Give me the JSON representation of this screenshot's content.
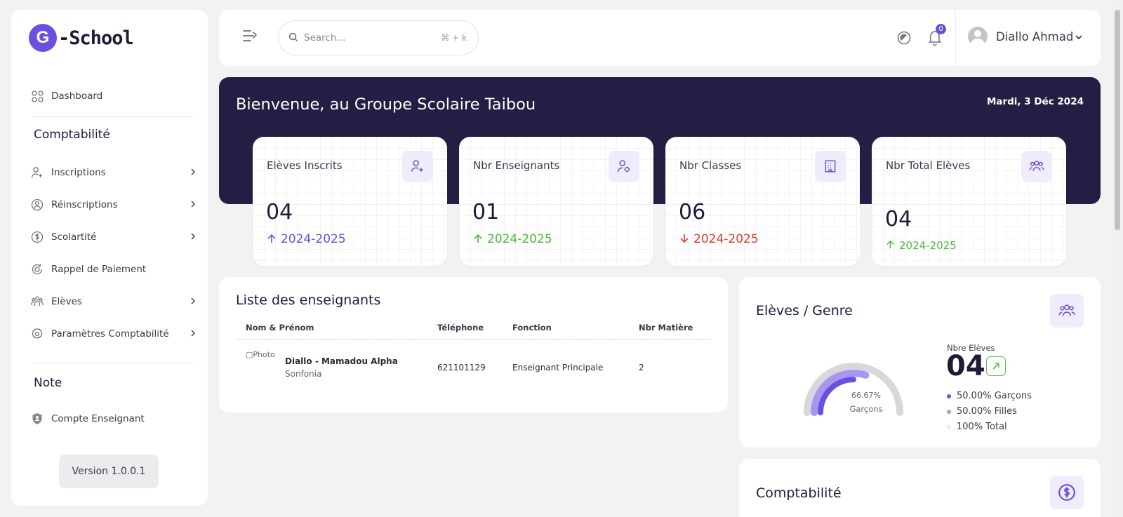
{
  "brand": {
    "logo_letter": "G",
    "name": "-School",
    "accent": "#6c4fe0"
  },
  "sidebar": {
    "dashboard": "Dashboard",
    "section1": "Comptabilité",
    "items": [
      {
        "label": "Inscriptions",
        "icon": "user-add-icon"
      },
      {
        "label": "Réinscriptions",
        "icon": "user-circle-icon"
      },
      {
        "label": "Scolartité",
        "icon": "dollar-circle-icon"
      },
      {
        "label": "Rappel de Paiement",
        "icon": "refresh-dollar-icon"
      },
      {
        "label": "Elèves",
        "icon": "users-icon"
      },
      {
        "label": "Paramètres Comptabilité",
        "icon": "gear-icon"
      }
    ],
    "section2": "Note",
    "note_item": "Compte Enseignant",
    "version": "Version 1.0.0.1"
  },
  "topbar": {
    "search_placeholder": "Search...",
    "search_shortcut": "⌘ + k",
    "notification_count": "0",
    "user_name": "Diallo Ahmad"
  },
  "banner": {
    "welcome": "Bienvenue, au Groupe Scolaire Taibou",
    "date": "Mardi, 3 Déc 2024"
  },
  "stats": [
    {
      "label": "Elèves Inscrits",
      "value": "04",
      "year": "2024-2025",
      "trend": "up",
      "color": "#6c4fe0"
    },
    {
      "label": "Nbr Enseignants",
      "value": "01",
      "year": "2024-2025",
      "trend": "up",
      "color": "#4cb83a"
    },
    {
      "label": "Nbr Classes",
      "value": "06",
      "year": "2024-2025",
      "trend": "down",
      "color": "#e5382a"
    },
    {
      "label": "Nbr Total Elèves",
      "value": "04",
      "year": "2024-2025",
      "trend": "up",
      "color": "#4cb83a"
    }
  ],
  "teachers": {
    "title": "Liste des enseignants",
    "columns": [
      "Nom & Prénom",
      "Téléphone",
      "Fonction",
      "Nbr Matière"
    ],
    "rows": [
      {
        "photo_alt": "Photo",
        "name": "Diallo - Mamadou Alpha",
        "location": "Sonfonia",
        "phone": "621101129",
        "fonction": "Enseignant Principale",
        "matieres": "2"
      }
    ]
  },
  "gender": {
    "title": "Elèves / Genre",
    "gauge_pct": "66.67%",
    "gauge_label": "Garçons",
    "gauge_fraction": 0.6667,
    "nbre_label": "Nbre Elèves",
    "nbre_value": "04",
    "legend": [
      {
        "text": "50.00% Garçons",
        "color": "#6c4fe0"
      },
      {
        "text": "50.00% Filles",
        "color": "#a796f0"
      },
      {
        "text": "100% Total",
        "color": "#ece8fb"
      }
    ]
  },
  "compta": {
    "title": "Comptabilité"
  }
}
